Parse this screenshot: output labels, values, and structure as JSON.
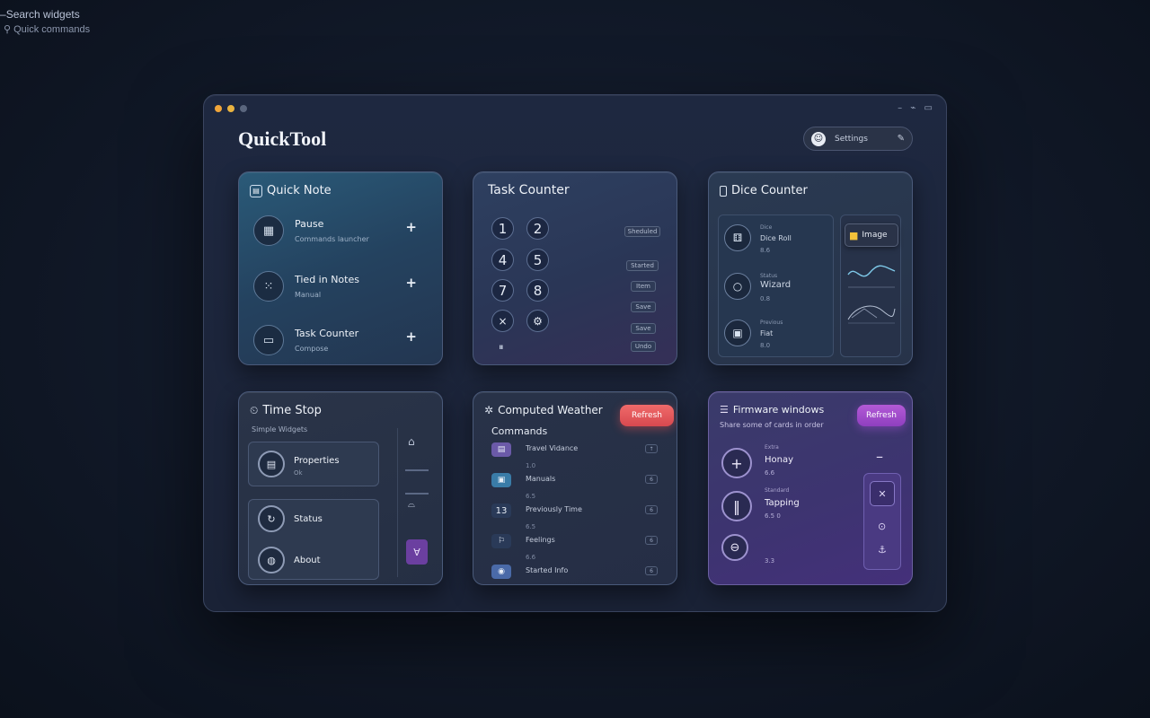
{
  "search": {
    "hint": "Search widgets",
    "subhint": "Quick commands"
  },
  "window": {
    "title": "QuickTool",
    "controls": "– ⌁ ▭",
    "user_chip": {
      "label": "Settings",
      "avatar": "☺",
      "edit": "✎"
    }
  },
  "quick_note": {
    "title": "Quick Note",
    "items": [
      {
        "label": "Pause",
        "sub": "Commands launcher",
        "icon": "grid-icon"
      },
      {
        "label": "Tied in Notes",
        "sub": "Manual",
        "icon": "dots-icon"
      },
      {
        "label": "Task Counter",
        "sub": "Compose",
        "icon": "window-icon"
      }
    ],
    "plus": "+"
  },
  "task_counter": {
    "title": "Task Counter",
    "keys": [
      "1",
      "2",
      "4",
      "5",
      "7",
      "8",
      "×",
      "⚙"
    ],
    "footer_key": "⏸",
    "tags": [
      "Sheduled",
      "Started",
      "Item",
      "Save",
      "Save",
      "Undo"
    ]
  },
  "dice_counter": {
    "title": "Dice Counter",
    "items": [
      {
        "t1": "Dice",
        "t2": "Dice Roll",
        "t3": "8.6",
        "icon": "dice-icon"
      },
      {
        "t1": "Status",
        "t2": "Wizard",
        "t3": "0.8",
        "icon": "circle-icon"
      },
      {
        "t1": "Previous",
        "t2": "Fiat",
        "t3": "8.0",
        "icon": "folder-icon"
      }
    ],
    "image_button": "Image"
  },
  "time_stop": {
    "title": "Time Stop",
    "subtitle": "Simple Widgets",
    "items": [
      {
        "label": "Properties",
        "sub": "Ok",
        "icon": "calendar-icon"
      },
      {
        "label": "Status",
        "sub": "",
        "icon": "refresh-icon"
      },
      {
        "label": "About",
        "sub": "",
        "icon": "globe-icon"
      }
    ]
  },
  "weather": {
    "title": "Computed Weather",
    "button": "Refresh",
    "commands_title": "Commands",
    "rows": [
      {
        "label": "Travel Vidance",
        "sub": "1.0",
        "icon": "▤",
        "badge": "↑"
      },
      {
        "label": "Manuals",
        "sub": "6.5",
        "icon": "▣",
        "badge": "6"
      },
      {
        "label": "Previously Time",
        "sub": "6.5",
        "icon": "13",
        "badge": "6"
      },
      {
        "label": "Feelings",
        "sub": "6.6",
        "icon": "⚐",
        "badge": "6"
      },
      {
        "label": "Started Info",
        "sub": "",
        "icon": "◉",
        "badge": "6"
      }
    ],
    "row_colors": [
      "#6b5aa8",
      "#3a7ca8",
      "#2a3a58",
      "#2a3a58",
      "#4a6aa8"
    ]
  },
  "firmware": {
    "title": "Firmware windows",
    "subtitle": "Share some of cards in order",
    "button": "Refresh",
    "items": [
      {
        "t1": "Extra",
        "t2": "Honay",
        "t3": "6.6",
        "icon": "+"
      },
      {
        "t1": "Standard",
        "t2": "Tapping",
        "t3": "6.5 0",
        "icon": "‖"
      },
      {
        "t1": "",
        "t2": "",
        "t3": "3.3",
        "icon": "⊖"
      }
    ],
    "minus": "–"
  }
}
